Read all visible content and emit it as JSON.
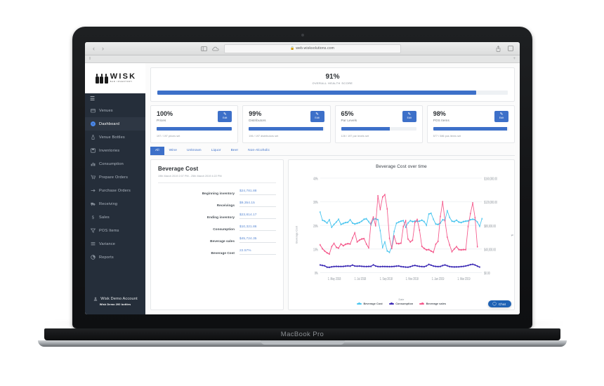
{
  "device": {
    "label": "MacBook Pro"
  },
  "browser": {
    "url": "web.wisksolutions.com",
    "lock_glyph": "A",
    "back_glyph": "‹",
    "forward_glyph": "›",
    "tab_grip": "‖",
    "new_tab": "+"
  },
  "brand": {
    "name": "WISK",
    "tagline": "BAR INVENTORY"
  },
  "sidebar": {
    "menu_icon": "☰",
    "items": [
      {
        "label": "Venues",
        "icon": "venue-icon",
        "active": false
      },
      {
        "label": "Dashboard",
        "icon": "dashboard-icon",
        "active": true
      },
      {
        "label": "Venue Bottles",
        "icon": "bottle-icon",
        "active": false
      },
      {
        "label": "Inventories",
        "icon": "inventory-icon",
        "active": false
      },
      {
        "label": "Consumption",
        "icon": "chart-bar-icon",
        "active": false
      },
      {
        "label": "Prepare Orders",
        "icon": "cart-icon",
        "active": false
      },
      {
        "label": "Purchase Orders",
        "icon": "arrow-right-icon",
        "active": false
      },
      {
        "label": "Receiving",
        "icon": "truck-icon",
        "active": false
      },
      {
        "label": "Sales",
        "icon": "dollar-icon",
        "active": false
      },
      {
        "label": "POS Items",
        "icon": "filter-icon",
        "active": false
      },
      {
        "label": "Variance",
        "icon": "list-icon",
        "active": false
      },
      {
        "label": "Reports",
        "icon": "pie-chart-icon",
        "active": false
      }
    ],
    "account": {
      "name": "Wisk Demo Account",
      "subtitle": "Wisk Demo 200 bottles",
      "icon": "user-icon"
    }
  },
  "health": {
    "percent": "91%",
    "label": "OVERALL HEALTH SCORE",
    "fill": 91,
    "color": "#3d70c9"
  },
  "kpis": [
    {
      "percent": "100%",
      "name": "Prices",
      "sub": "197 / 197 prices set",
      "fill": 100,
      "edit_label": "Edit"
    },
    {
      "percent": "99%",
      "name": "Distributors",
      "sub": "196 / 197 distributors set",
      "fill": 99,
      "edit_label": "Edit"
    },
    {
      "percent": "65%",
      "name": "Par Levels",
      "sub": "128 / 197 par levels set",
      "fill": 65,
      "edit_label": "Edit"
    },
    {
      "percent": "98%",
      "name": "POS Items",
      "sub": "577 / 586 pos items set",
      "fill": 98,
      "edit_label": "Edit"
    }
  ],
  "filter_tabs": [
    {
      "label": "All",
      "active": true
    },
    {
      "label": "Wine",
      "active": false
    },
    {
      "label": "Unknown",
      "active": false
    },
    {
      "label": "Liquor",
      "active": false
    },
    {
      "label": "Beer",
      "active": false
    },
    {
      "label": "Non-Alcoholic",
      "active": false
    }
  ],
  "beverage_cost": {
    "title": "Beverage Cost",
    "date_range": "19th March 2019 2:07 PM - 25th March 2019 4:22 PM",
    "rows": [
      {
        "label": "Beginning inventory",
        "value": "$24,781.88"
      },
      {
        "label": "Receivings",
        "value": "$9,354.15"
      },
      {
        "label": "Ending inventory",
        "value": "$23,814.17"
      },
      {
        "label": "Consumption",
        "value": "$10,321.86"
      },
      {
        "label": "Beverage sales",
        "value": "$45,724.35"
      },
      {
        "label": "Beverage Cost",
        "value": "22.57%"
      }
    ]
  },
  "chat": {
    "label": "Chat",
    "icon": "chat-bubble-icon"
  },
  "chart_data": {
    "type": "line",
    "title": "Beverage Cost over time",
    "xlabel": "Date",
    "ylabel": "Beverage Cost",
    "grid": true,
    "legend_position": "bottom",
    "x_tick_labels": [
      "1. May 2018",
      "1. Jul 2018",
      "1. Sep 2018",
      "1. Nov 2018",
      "1. Jan 2019",
      "1. Mar 2019"
    ],
    "y_left_ticks": [
      "0%",
      "10%",
      "20%",
      "30%",
      "40%"
    ],
    "y_left_values": [
      0,
      10,
      20,
      30,
      40
    ],
    "ylim_left": [
      0,
      40
    ],
    "y_right_ticks": [
      "$0.00",
      "$40,000.00",
      "$80,000.00",
      "$120,000.00",
      "$160,000.00"
    ],
    "y_right_values": [
      0,
      40000,
      80000,
      120000,
      160000
    ],
    "ylim_right": [
      0,
      160000
    ],
    "series": [
      {
        "name": "Beverage Cost",
        "color": "#4cc6ef",
        "axis": "left",
        "unit": "%",
        "values": [
          25.6,
          22.2,
          21.8,
          21.0,
          22.4,
          19.2,
          20.4,
          21.4,
          22.6,
          20.4,
          20.8,
          21.2,
          21.3,
          22.4,
          21.0,
          20.6,
          20.9,
          21.2,
          21.8,
          22.6,
          22.8,
          21.6,
          20.2,
          22.6,
          22.8,
          22.4,
          17.8,
          10.6,
          13.0,
          9.2,
          8.6,
          11.0,
          17.4,
          20.9,
          21.4,
          21.8,
          22.0,
          19.2,
          21.0,
          22.0,
          21.6,
          21.8,
          21.7,
          21.8,
          22.2,
          21.6,
          20.0,
          24.8,
          25.1,
          22.6,
          20.6,
          20.4,
          21.0,
          22.4,
          22.2,
          26.2,
          23.4,
          21.8,
          21.6,
          22.2,
          21.4,
          21.2,
          21.6,
          21.8,
          21.9,
          22.4,
          22.6,
          22.4,
          21.4,
          19.6,
          22.8
        ]
      },
      {
        "name": "Consumption",
        "color": "#3d2bb5",
        "axis": "right",
        "unit": "$",
        "values": [
          13000,
          12200,
          11500,
          9200,
          9000,
          9800,
          10300,
          10600,
          10400,
          10400,
          10500,
          11000,
          11400,
          11000,
          12800,
          11200,
          10900,
          11100,
          10700,
          10400,
          10300,
          10500,
          10600,
          13200,
          11200,
          10300,
          10100,
          10400,
          10300,
          10200,
          10100,
          10200,
          10500,
          11000,
          11300,
          10200,
          9800,
          9400,
          9200,
          10000,
          11500,
          12200,
          11300,
          10600,
          10200,
          10000,
          11400,
          13900,
          12600,
          11100,
          10500,
          10200,
          10400,
          12000,
          13000,
          11600,
          10200,
          9800,
          9600,
          9700,
          9800,
          10200,
          10600,
          11300,
          12200,
          13500,
          14100,
          12900,
          11000,
          9400
        ]
      },
      {
        "name": "Beverage sales",
        "color": "#f4578a",
        "axis": "right",
        "unit": "$",
        "values": [
          47000,
          40500,
          36500,
          33500,
          31500,
          44000,
          49500,
          43000,
          41500,
          48500,
          45500,
          48000,
          49000,
          48500,
          58500,
          67500,
          52000,
          55000,
          57000,
          57500,
          48500,
          42000,
          84000,
          94000,
          79500,
          130000,
          107000,
          128000,
          132000,
          108000,
          58000,
          41000,
          62000,
          49500,
          49000,
          50000,
          78000,
          88000,
          57000,
          52000,
          55000,
          85000,
          90000,
          72000,
          44500,
          41000,
          38500,
          39000,
          36500,
          34500,
          48000,
          53000,
          95000,
          120000,
          88000,
          60000,
          47000,
          35500,
          40000,
          44000,
          39000,
          38500,
          39000,
          39000,
          78000,
          100000,
          118000,
          93000,
          44000
        ]
      }
    ]
  }
}
